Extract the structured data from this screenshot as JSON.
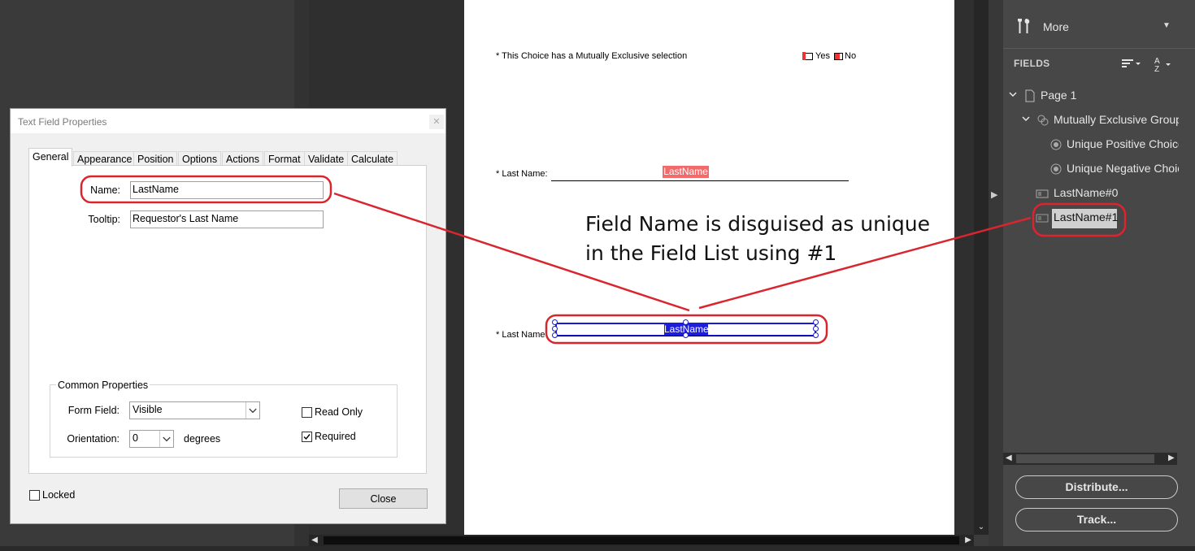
{
  "document": {
    "choice_label": "* This Choice has a Mutually Exclusive selection",
    "choice_yes": "Yes",
    "choice_no": "No",
    "last_name_label_1": "* Last Name:",
    "field_1_name": "LastName",
    "last_name_label_2": "* Last Name:",
    "field_2_name": "LastName"
  },
  "callout": {
    "line1": "Field Name is disguised as unique",
    "line2": "in the Field List using #1",
    "color": "#d9262e"
  },
  "dialog": {
    "title": "Text Field Properties",
    "tabs": [
      "General",
      "Appearance",
      "Position",
      "Options",
      "Actions",
      "Format",
      "Validate",
      "Calculate"
    ],
    "active_tab": "General",
    "name_label": "Name:",
    "name_value": "LastName",
    "tooltip_label": "Tooltip:",
    "tooltip_value": "Requestor's Last Name",
    "common_properties_title": "Common Properties",
    "form_field_label": "Form Field:",
    "form_field_value": "Visible",
    "orientation_label": "Orientation:",
    "orientation_value": "0",
    "degrees_label": "degrees",
    "read_only_label": "Read Only",
    "read_only_checked": false,
    "required_label": "Required",
    "required_checked": true,
    "locked_label": "Locked",
    "locked_checked": false,
    "close_label": "Close"
  },
  "panel": {
    "more_label": "More",
    "fields_title": "FIELDS",
    "tree": {
      "page": "Page 1",
      "group": "Mutually Exclusive Group",
      "choice_positive": "Unique Positive Choice",
      "choice_negative": "Unique Negative Choice",
      "field_0": "LastName#0",
      "field_1": "LastName#1"
    },
    "distribute_label": "Distribute...",
    "track_label": "Track..."
  },
  "colors": {
    "accent_red": "#d9262e",
    "field_blue": "#1d1ddd",
    "field_highlight_red": "#f26a6a"
  }
}
